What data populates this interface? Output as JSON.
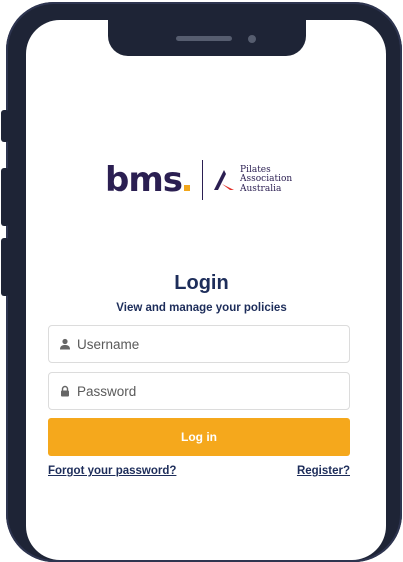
{
  "brand": {
    "primary_logo": "bms",
    "partner_lines": [
      "Pilates",
      "Association",
      "Australia"
    ],
    "colors": {
      "navy": "#2b1f52",
      "accent": "#f5a81c",
      "title": "#1d2d5a"
    }
  },
  "login": {
    "title": "Login",
    "subtitle": "View and manage your policies",
    "username_placeholder": "Username",
    "password_placeholder": "Password",
    "submit_label": "Log in",
    "forgot_label": "Forgot your password?",
    "register_label": "Register?"
  },
  "icons": {
    "username": "user-icon",
    "password": "lock-icon"
  }
}
